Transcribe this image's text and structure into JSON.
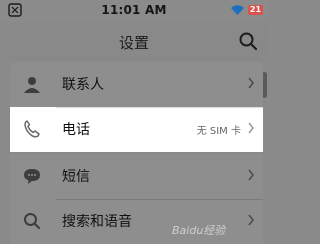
{
  "status_bar": {
    "time": "11:01 AM",
    "battery": "21",
    "icons": [
      "notification-icon",
      "wifi-icon",
      "battery-icon"
    ]
  },
  "header": {
    "title": "设置",
    "search_icon": "search-icon"
  },
  "rows": [
    {
      "label": "联系人",
      "value": "",
      "icon": "contact-person-icon",
      "state": "dim"
    },
    {
      "label": "电话",
      "value": "无 SIM 卡",
      "icon": "phone-icon",
      "state": "active"
    },
    {
      "label": "短信",
      "value": "",
      "icon": "message-bubble-icon",
      "state": "dim"
    },
    {
      "label": "搜索和语音",
      "value": "",
      "icon": "search-icon",
      "state": "dim"
    }
  ],
  "watermark": "Baidu经验",
  "colors": {
    "overlay": "#8a8a8a",
    "active_row": "#ffffff",
    "battery": "#d9534f"
  }
}
